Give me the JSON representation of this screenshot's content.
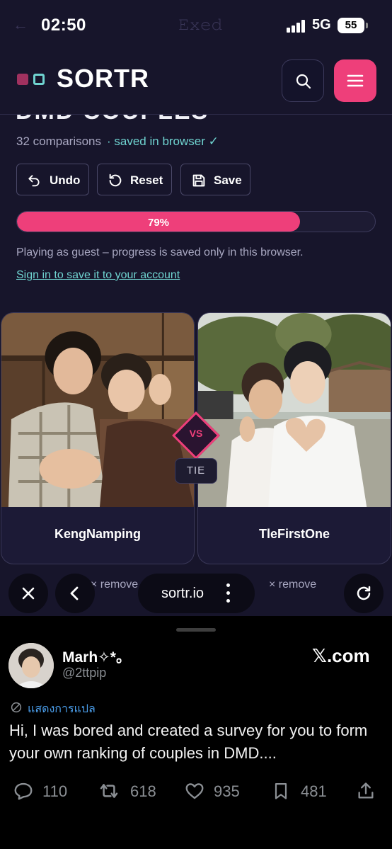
{
  "status_bar": {
    "time": "02:50",
    "network": "5G",
    "battery": "55"
  },
  "app": {
    "logo": "SORTR",
    "search_icon": "search-icon",
    "menu_icon": "hamburger-menu-icon",
    "heading_fragment": "DMD COUPLES"
  },
  "sort": {
    "comparisons": "32 comparisons",
    "saved_status": "· saved in browser ✓",
    "buttons": {
      "undo": "Undo",
      "reset": "Reset",
      "save": "Save"
    },
    "progress": {
      "value": 0.79,
      "label": "79%"
    },
    "guest_note": "Playing as guest – progress is saved only in this browser.",
    "signin_link": "Sign in to save it to your account"
  },
  "matchup": {
    "left": {
      "name": "KengNamping",
      "remove": "× remove"
    },
    "right": {
      "name": "TleFirstOne",
      "remove": "× remove"
    },
    "vs": "VS",
    "tie": "TIE"
  },
  "browser": {
    "url": "sortr.io"
  },
  "tweet": {
    "author": "Marh✧*。",
    "username": "@2ttpip",
    "source": "𝕏.com",
    "translate": "แสดงการแปล",
    "text": "Hi, I was bored and created a survey for you to form your own ranking of couples in DMD....",
    "stats": {
      "replies": "110",
      "reposts": "618",
      "likes": "935",
      "bookmarks": "481"
    }
  },
  "colors": {
    "accent": "#ee3f7a",
    "teal": "#6fd3d0",
    "background": "#17152b"
  }
}
